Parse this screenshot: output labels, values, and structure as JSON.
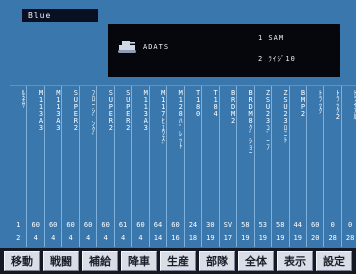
{
  "header": {
    "side_label": "Blue"
  },
  "info": {
    "unit_name": "ADATS",
    "line1": "1 SAM",
    "line2": "2 ﾗｲｼﾞ10",
    "icon": "tank-icon"
  },
  "units": [
    {
      "name": "ﾙﾈｻ",
      "v1": "1",
      "v2": "2"
    },
    {
      "name": "M113A3",
      "v1": "60",
      "v2": "4"
    },
    {
      "name": "M113A3",
      "v1": "60",
      "v2": "4"
    },
    {
      "name": "SUPER2",
      "v1": "60",
      "v2": "4"
    },
    {
      "name": "ﾌﾛｰｼﾞﾝｸﾞ",
      "v1": "60",
      "v2": "4"
    },
    {
      "name": "SUPER2",
      "v1": "60",
      "v2": "4"
    },
    {
      "name": "SUPER2",
      "v1": "61",
      "v2": "4"
    },
    {
      "name": "M113A3",
      "v1": "60",
      "v2": "4"
    },
    {
      "name": "M117ﾋｭｳｽﾞ",
      "v1": "64",
      "v2": "14"
    },
    {
      "name": "M128ﾊﾟﾚｯﾄ",
      "v1": "60",
      "v2": "16"
    },
    {
      "name": "T180",
      "v1": "24",
      "v2": "18"
    },
    {
      "name": "T184",
      "v1": "30",
      "v2": "19"
    },
    {
      "name": "BRDM2",
      "v1": "SV",
      "v2": "17"
    },
    {
      "name": "BRDM8ｸﾞｼｮｰ",
      "v1": "58",
      "v2": "19"
    },
    {
      "name": "ZSU23ｺﾞｰﾌ",
      "v1": "53",
      "v2": "19"
    },
    {
      "name": "ZSU23ﾛﾆﾄ",
      "v1": "58",
      "v2": "19"
    },
    {
      "name": "BMP2",
      "v1": "44",
      "v2": "19"
    },
    {
      "name": "ﾄﾗｯｸ",
      "v1": "60",
      "v2": "20"
    },
    {
      "name": "ﾄﾗｯｸ2",
      "v1": "0",
      "v2": "28"
    },
    {
      "name": "ﾄﾗｲｱﾙ",
      "v1": "0",
      "v2": "28"
    },
    {
      "name": "ﾄﾗｲｱﾙ2",
      "v1": "0",
      "v2": "21"
    }
  ],
  "menu": [
    "移動",
    "戦闘",
    "補給",
    "降車",
    "生産",
    "部隊",
    "全体",
    "表示",
    "設定"
  ],
  "colors": {
    "panel": "#3a77ad",
    "info_bg": "#05070c",
    "menu_bg": "#151925",
    "button_face": "#d9dde5"
  }
}
